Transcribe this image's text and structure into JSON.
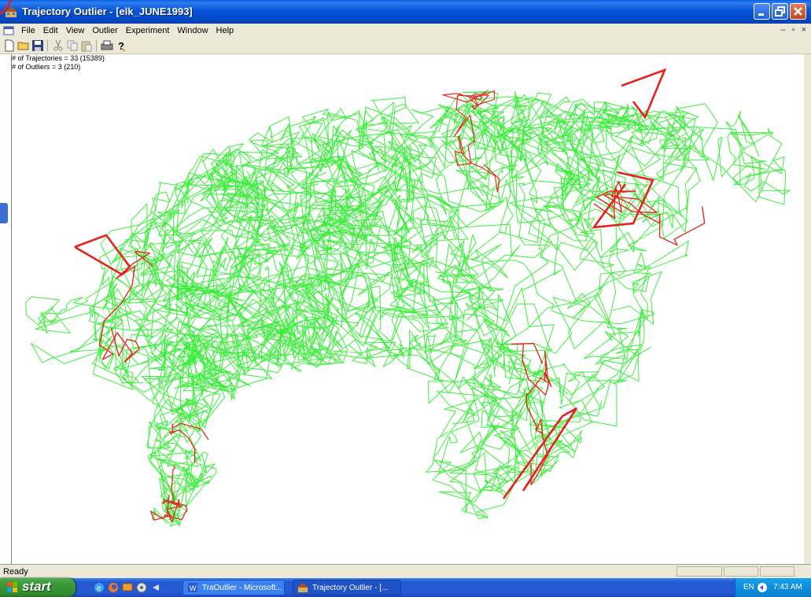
{
  "window": {
    "title": "Trajectory Outlier - [elk_JUNE1993]",
    "icon": "app-icon"
  },
  "menu": {
    "items": [
      "File",
      "Edit",
      "View",
      "Outlier",
      "Experiment",
      "Window",
      "Help"
    ]
  },
  "toolbar": {
    "buttons": [
      "new-icon",
      "open-icon",
      "save-icon",
      "cut-icon",
      "copy-icon",
      "paste-icon",
      "print-icon",
      "help-icon"
    ]
  },
  "stats": {
    "trajectories": "# of Trajectories = 33 (15389)",
    "outliers": "# of Outliers = 3 (210)"
  },
  "status": {
    "text": "Ready"
  },
  "taskbar": {
    "start_label": "start",
    "tasks": [
      {
        "label": "TraOutlier - Microsoft...",
        "icon": "word-doc-icon"
      },
      {
        "label": "Trajectory Outlier - [...",
        "icon": "app-icon"
      }
    ],
    "tray_lang": "EN",
    "clock": "7:43 AM"
  },
  "colors": {
    "normal_trajectory": "#33ee33",
    "outlier_trajectory": "#e82020",
    "titlebar": "#0653d8",
    "taskbar": "#2459d4"
  }
}
